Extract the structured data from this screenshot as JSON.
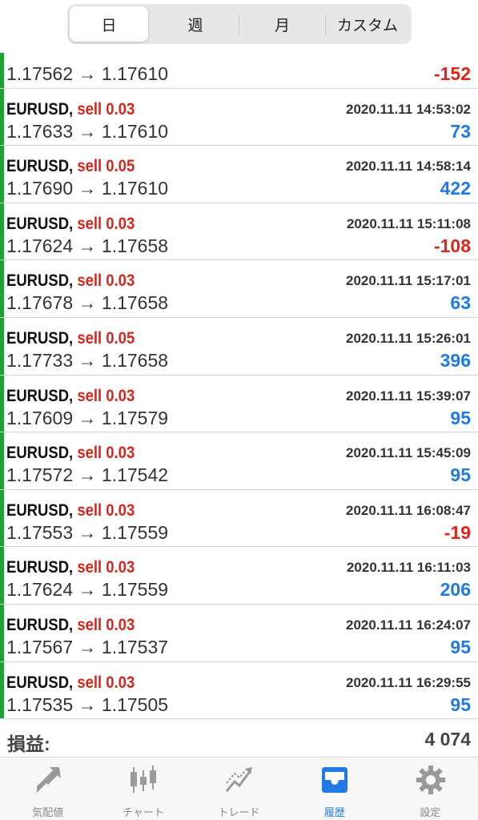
{
  "period_tabs": [
    "日",
    "週",
    "月",
    "カスタム"
  ],
  "active_period": "日",
  "partial_row": {
    "prices": "1.17562 → 1.17610",
    "profit": "-152",
    "profit_sign": "neg"
  },
  "trades": [
    {
      "symbol": "EURUSD,",
      "side": "sell 0.03",
      "time": "2020.11.11 14:53:02",
      "prices": "1.17633 → 1.17610",
      "profit": "73",
      "profit_sign": "pos"
    },
    {
      "symbol": "EURUSD,",
      "side": "sell 0.05",
      "time": "2020.11.11 14:58:14",
      "prices": "1.17690 → 1.17610",
      "profit": "422",
      "profit_sign": "pos"
    },
    {
      "symbol": "EURUSD,",
      "side": "sell 0.03",
      "time": "2020.11.11 15:11:08",
      "prices": "1.17624 → 1.17658",
      "profit": "-108",
      "profit_sign": "neg"
    },
    {
      "symbol": "EURUSD,",
      "side": "sell 0.03",
      "time": "2020.11.11 15:17:01",
      "prices": "1.17678 → 1.17658",
      "profit": "63",
      "profit_sign": "pos"
    },
    {
      "symbol": "EURUSD,",
      "side": "sell 0.05",
      "time": "2020.11.11 15:26:01",
      "prices": "1.17733 → 1.17658",
      "profit": "396",
      "profit_sign": "pos"
    },
    {
      "symbol": "EURUSD,",
      "side": "sell 0.03",
      "time": "2020.11.11 15:39:07",
      "prices": "1.17609 → 1.17579",
      "profit": "95",
      "profit_sign": "pos"
    },
    {
      "symbol": "EURUSD,",
      "side": "sell 0.03",
      "time": "2020.11.11 15:45:09",
      "prices": "1.17572 → 1.17542",
      "profit": "95",
      "profit_sign": "pos"
    },
    {
      "symbol": "EURUSD,",
      "side": "sell 0.03",
      "time": "2020.11.11 16:08:47",
      "prices": "1.17553 → 1.17559",
      "profit": "-19",
      "profit_sign": "neg"
    },
    {
      "symbol": "EURUSD,",
      "side": "sell 0.03",
      "time": "2020.11.11 16:11:03",
      "prices": "1.17624 → 1.17559",
      "profit": "206",
      "profit_sign": "pos"
    },
    {
      "symbol": "EURUSD,",
      "side": "sell 0.03",
      "time": "2020.11.11 16:24:07",
      "prices": "1.17567 → 1.17537",
      "profit": "95",
      "profit_sign": "pos"
    },
    {
      "symbol": "EURUSD,",
      "side": "sell 0.03",
      "time": "2020.11.11 16:29:55",
      "prices": "1.17535 → 1.17505",
      "profit": "95",
      "profit_sign": "pos"
    }
  ],
  "summary": {
    "label": "損益:",
    "value": "4 074"
  },
  "bottom_tabs": [
    {
      "label": "気配値",
      "icon": "quotes-icon"
    },
    {
      "label": "チャート",
      "icon": "chart-icon"
    },
    {
      "label": "トレード",
      "icon": "trade-icon"
    },
    {
      "label": "履歴",
      "icon": "history-icon"
    },
    {
      "label": "設定",
      "icon": "settings-icon"
    }
  ],
  "active_bottom_tab": "履歴",
  "colors": {
    "position_bar": "#1fa032",
    "sell_text": "#d9261c",
    "profit_negative": "#e0251a",
    "profit_positive": "#1f7be3",
    "active_tab": "#1f7be3",
    "inactive_tab": "#9a9a9a"
  }
}
